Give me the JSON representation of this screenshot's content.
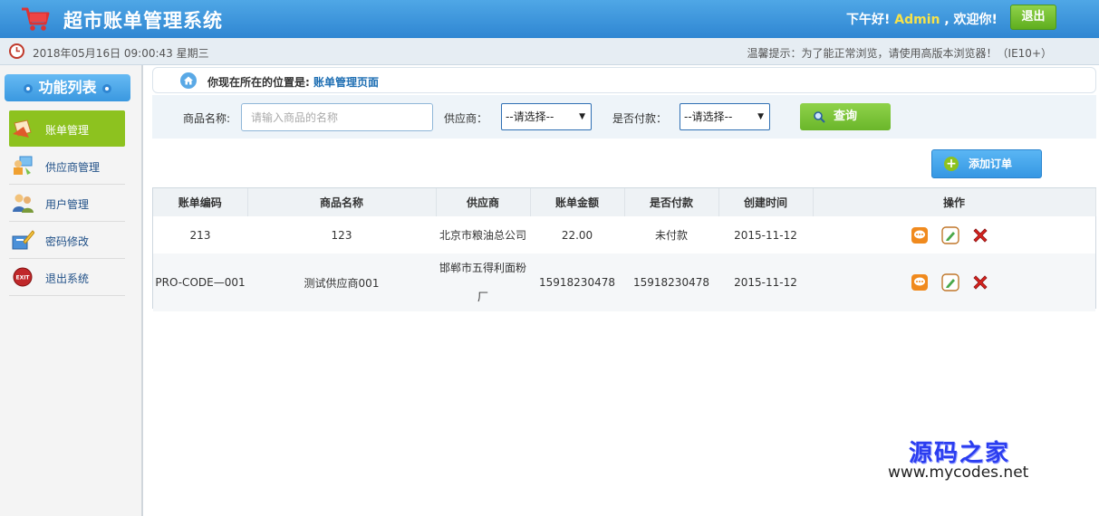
{
  "header": {
    "app_title": "超市账单管理系统",
    "greeting": "下午好!",
    "username": "Admin",
    "welcome": ", 欢迎你!",
    "logout_label": "退出",
    "bg_color": "#2f86d2"
  },
  "infobar": {
    "datetime": "2018年05月16日 09:00:43 星期三",
    "tip": "温馨提示：为了能正常浏览，请使用高版本浏览器！（IE10+）"
  },
  "sidebar": {
    "title": "功能列表",
    "items": [
      {
        "label": "账单管理",
        "icon": "bill-icon",
        "active": true
      },
      {
        "label": "供应商管理",
        "icon": "supplier-icon",
        "active": false
      },
      {
        "label": "用户管理",
        "icon": "users-icon",
        "active": false
      },
      {
        "label": "密码修改",
        "icon": "password-icon",
        "active": false
      },
      {
        "label": "退出系统",
        "icon": "exit-icon",
        "active": false
      }
    ]
  },
  "breadcrumb": {
    "prefix": "你现在所在的位置是:",
    "page": "账单管理页面"
  },
  "search": {
    "product_label": "商品名称:",
    "product_placeholder": "请输入商品的名称",
    "supplier_label": "供应商：",
    "supplier_value": "--请选择--",
    "paid_label": "是否付款：",
    "paid_value": "--请选择--",
    "query_label": "查询"
  },
  "add_button": {
    "label": "添加订单"
  },
  "table": {
    "headers": [
      "账单编码",
      "商品名称",
      "供应商",
      "账单金额",
      "是否付款",
      "创建时间",
      "操作"
    ],
    "rows": [
      {
        "code": "213",
        "product": "123",
        "supplier": "北京市粮油总公司",
        "amount": "22.00",
        "paid": "未付款",
        "created": "2015-11-12"
      },
      {
        "code": "PRO-CODE—001",
        "product": "测试供应商001",
        "supplier": "邯郸市五得利面粉厂",
        "amount": "15918230478",
        "paid": "15918230478",
        "created": "2015-11-12"
      }
    ]
  },
  "watermark": {
    "cn": "源码之家",
    "url": "www.mycodes.net"
  }
}
